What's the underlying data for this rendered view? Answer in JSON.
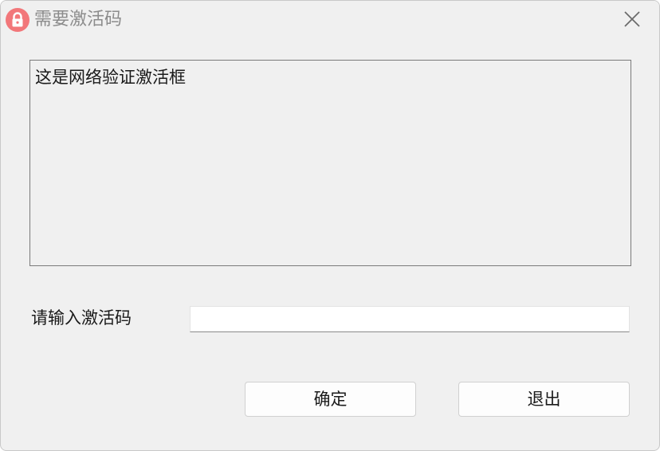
{
  "window": {
    "title": "需要激活码",
    "app_icon": "lock-icon",
    "close_icon": "close-icon",
    "accent_color": "#f2777a"
  },
  "message": {
    "text": "这是网络验证激活框"
  },
  "activation": {
    "label": "请输入激活码",
    "value": "",
    "placeholder": ""
  },
  "buttons": {
    "ok_label": "确定",
    "exit_label": "退出"
  }
}
